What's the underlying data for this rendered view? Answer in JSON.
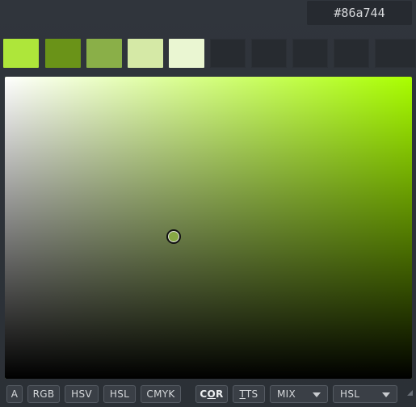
{
  "hex_value": "#86a744",
  "current_color": "#86a744",
  "picker_hue_color": "#aaff00",
  "cursor_position": {
    "saturation_fraction": 0.415,
    "brightness_fraction": 0.47
  },
  "swatches": [
    {
      "color": "#aee63a"
    },
    {
      "color": "#6a9318"
    },
    {
      "color": "#8aaf48"
    },
    {
      "color": "#d5e9a6"
    },
    {
      "color": "#eaf6d2"
    },
    {
      "color": ""
    },
    {
      "color": ""
    },
    {
      "color": ""
    },
    {
      "color": ""
    },
    {
      "color": ""
    }
  ],
  "toolbar": {
    "alpha_label": "A",
    "rgb_label": "RGB",
    "hsv_label": "HSV",
    "hsl_label": "HSL",
    "cmyk_label": "CMYK",
    "cor_label": "COR",
    "tts_label": "TTS",
    "mix_label": "MIX",
    "mode_label": "HSL"
  },
  "icons": {
    "resize_grip": "resize-grip-icon",
    "dropdown": "chevron-down-icon"
  }
}
